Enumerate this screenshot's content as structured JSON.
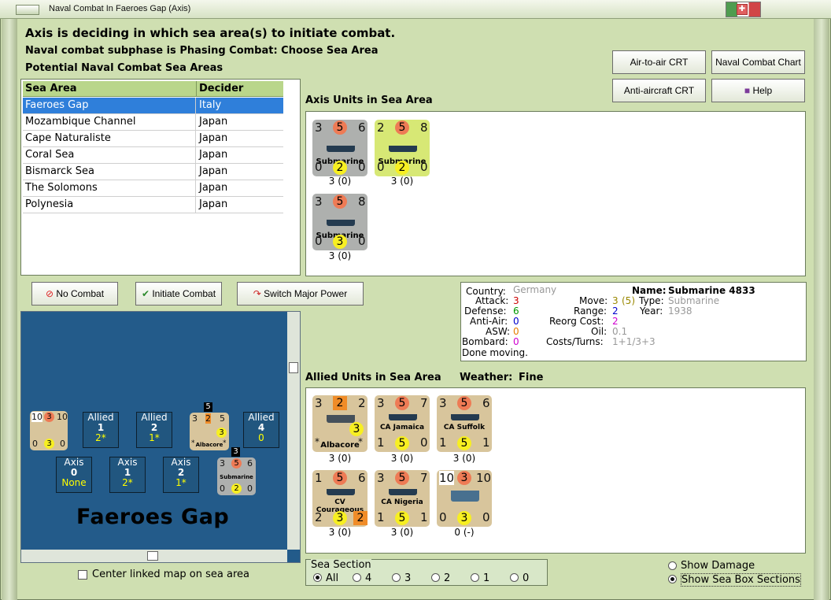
{
  "window": {
    "title": "Naval Combat In Faeroes Gap (Axis)"
  },
  "messages": {
    "line1": "Axis is deciding in which sea area(s) to initiate combat.",
    "line2": "Naval combat subphase is Phasing Combat: Choose Sea Area",
    "line3": "Potential Naval Combat Sea Areas"
  },
  "sea_areas": {
    "headers": [
      "Sea Area",
      "Decider"
    ],
    "rows": [
      [
        "Faeroes Gap",
        "Italy"
      ],
      [
        "Mozambique Channel",
        "Japan"
      ],
      [
        "Cape Naturaliste",
        "Japan"
      ],
      [
        "Coral Sea",
        "Japan"
      ],
      [
        "Bismarck Sea",
        "Japan"
      ],
      [
        "The Solomons",
        "Japan"
      ],
      [
        "Polynesia",
        "Japan"
      ]
    ]
  },
  "buttons": {
    "air_to_air": "Air-to-air CRT",
    "naval_chart": "Naval Combat Chart",
    "anti_aircraft": "Anti-aircraft CRT",
    "help": "Help",
    "no_combat": "No Combat",
    "initiate": "Initiate Combat",
    "switch": "Switch Major Power"
  },
  "axis_section": {
    "label": "Axis Units in Sea Area",
    "units": [
      {
        "top": [
          "3",
          "5",
          "6"
        ],
        "bottom": [
          "0",
          "2",
          "0"
        ],
        "name": "Submarine",
        "status": "3 (0)",
        "color": "#aeb0ae"
      },
      {
        "top": [
          "2",
          "5",
          "8"
        ],
        "bottom": [
          "0",
          "2",
          "0"
        ],
        "name": "Submarine",
        "status": "3 (0)",
        "color": "#d7e875"
      },
      {
        "top": [
          "3",
          "5",
          "8"
        ],
        "bottom": [
          "0",
          "3",
          "0"
        ],
        "name": "Submarine",
        "status": "3 (0)",
        "color": "#aeb0ae"
      }
    ]
  },
  "info": {
    "country_label": "Country:",
    "country": "Germany",
    "attack_label": "Attack:",
    "attack": "3",
    "defense_label": "Defense:",
    "defense": "6",
    "antiair_label": "Anti-Air:",
    "antiair": "0",
    "asw_label": "ASW:",
    "asw": "0",
    "bombard_label": "Bombard:",
    "bombard": "0",
    "done": "Done moving.",
    "name_label": "Name:",
    "name": "Submarine 4833",
    "move_label": "Move:",
    "move": "3",
    "move_extra": "(5)",
    "type_label": "Type:",
    "type": "Submarine",
    "range_label": "Range:",
    "range": "2",
    "year_label": "Year:",
    "year": "1938",
    "reorg_label": "Reorg Cost:",
    "reorg": "2",
    "oil_label": "Oil:",
    "oil": "0.1",
    "costs_label": "Costs/Turns:",
    "costs": "1+1/3+3"
  },
  "allied_section": {
    "label": "Allied Units in Sea Area",
    "weather_label": "Weather:",
    "weather": "Fine",
    "units": [
      {
        "top": [
          "3",
          "2",
          "2"
        ],
        "bottom": [
          "*",
          "3",
          "*"
        ],
        "name": "Albacore",
        "status": "3 (0)"
      },
      {
        "top": [
          "3",
          "5",
          "7"
        ],
        "bottom": [
          "1",
          "5",
          "0"
        ],
        "name": "CA Jamaica",
        "status": "3 (0)"
      },
      {
        "top": [
          "3",
          "5",
          "6"
        ],
        "bottom": [
          "1",
          "5",
          "1"
        ],
        "name": "CA Suffolk",
        "status": "3 (0)"
      },
      {
        "top": [
          "1",
          "5",
          "6"
        ],
        "bottom": [
          "2",
          "3",
          "2"
        ],
        "name": "CV Courageous",
        "status": "3 (0)"
      },
      {
        "top": [
          "3",
          "5",
          "7"
        ],
        "bottom": [
          "1",
          "5",
          "1"
        ],
        "name": "CA Nigeria",
        "status": "3 (0)"
      },
      {
        "top": [
          "10",
          "3",
          "10"
        ],
        "bottom": [
          "0",
          "3",
          "0"
        ],
        "name": "",
        "status": "0 (-)"
      }
    ]
  },
  "map": {
    "title": "Faeroes Gap",
    "allied_boxes": [
      [
        "Allied",
        "1",
        "2*"
      ],
      [
        "Allied",
        "2",
        "1*"
      ],
      [
        "Allied",
        "4",
        "0"
      ]
    ],
    "axis_boxes": [
      [
        "Axis",
        "0",
        "None"
      ],
      [
        "Axis",
        "1",
        "2*"
      ],
      [
        "Axis",
        "2",
        "1*"
      ]
    ],
    "counter1": {
      "top": [
        "10",
        "3",
        "10"
      ],
      "bottom": [
        "0",
        "3",
        "0"
      ]
    },
    "counter2": {
      "top": [
        "3",
        "2",
        "5"
      ],
      "bottom": [
        "*",
        "3",
        "*"
      ],
      "name": "Albacore",
      "stack": "5"
    },
    "counter3": {
      "top": [
        "3",
        "5",
        "6"
      ],
      "bottom": [
        "0",
        "2",
        "0"
      ],
      "name": "Submarine",
      "stack": "3"
    }
  },
  "options": {
    "center_map": "Center linked map on sea area",
    "sea_section_label": "Sea Section",
    "sea_options": [
      "All",
      "4",
      "3",
      "2",
      "1",
      "0"
    ],
    "show_damage": "Show Damage",
    "show_sections": "Show Sea Box Sections"
  }
}
